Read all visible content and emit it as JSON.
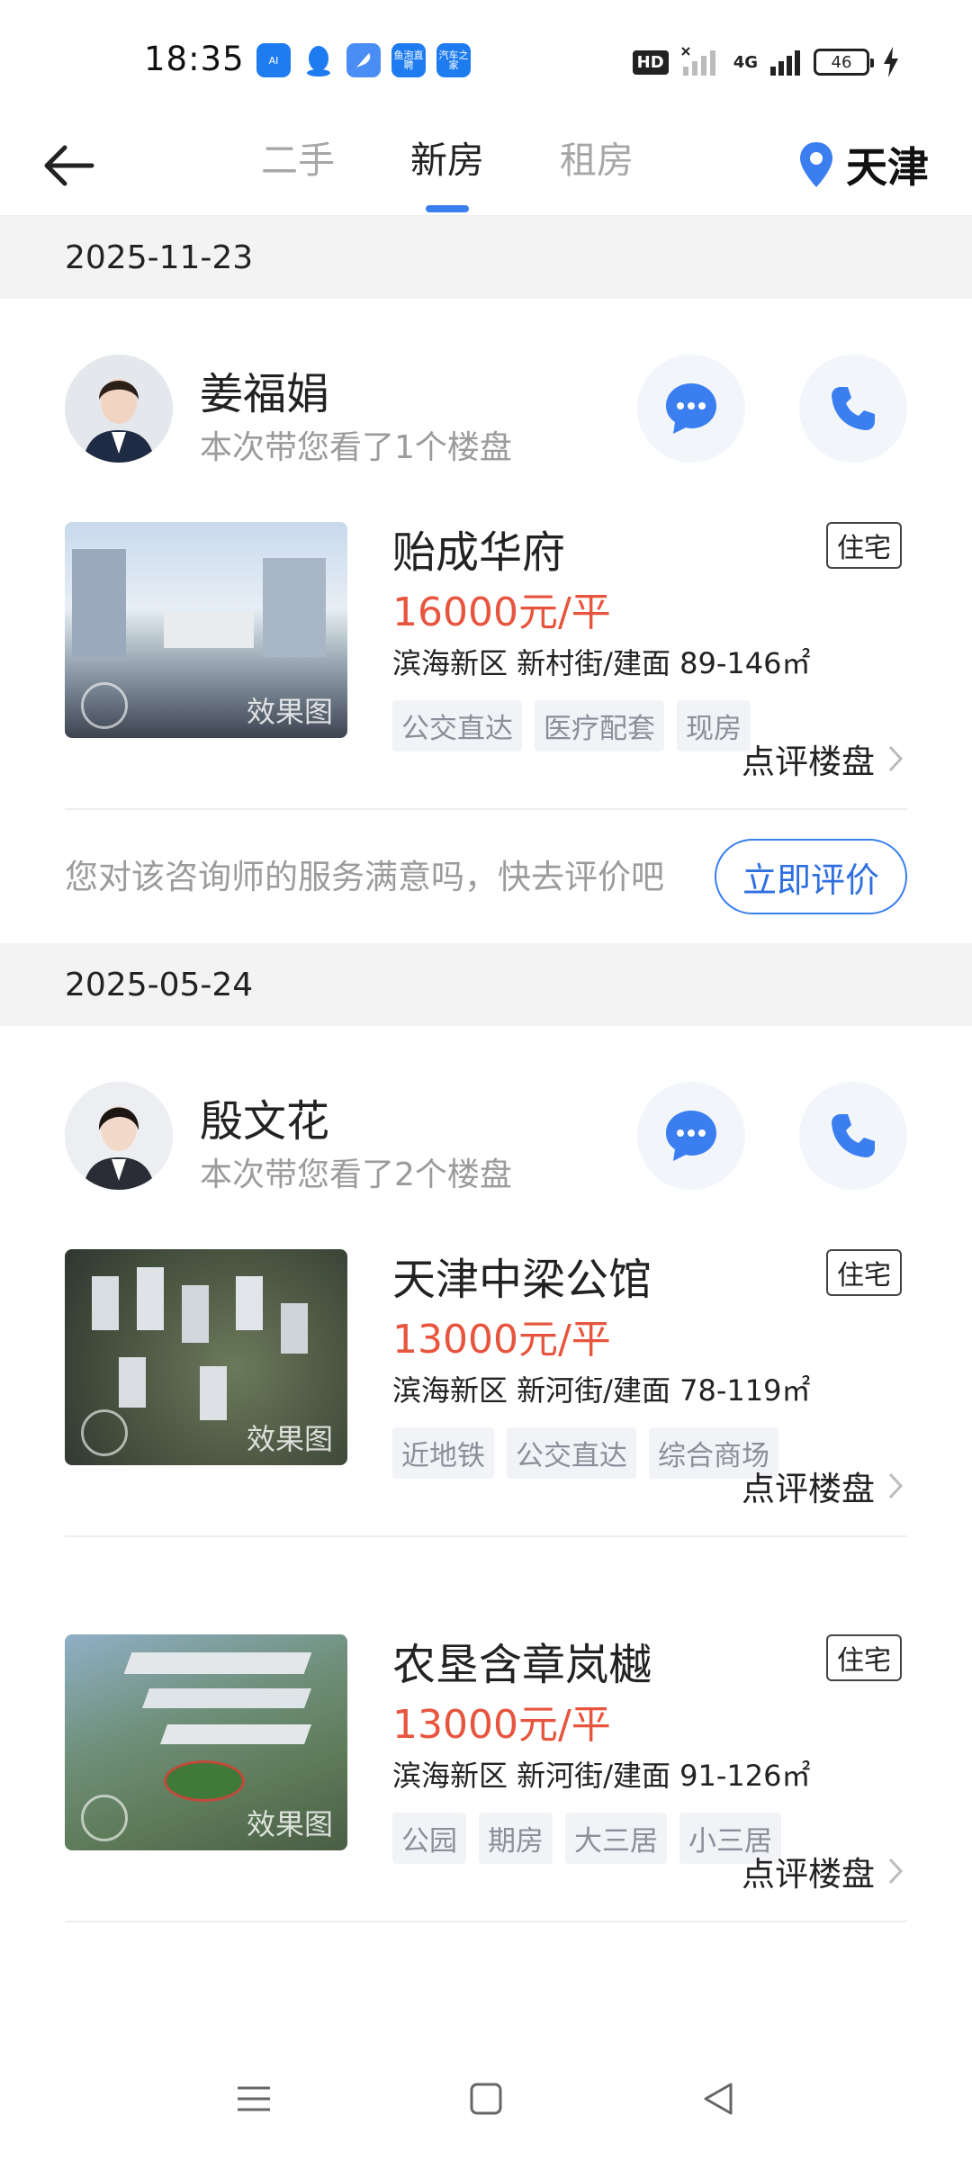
{
  "status_bar": {
    "time": "18:35",
    "app_icons": [
      {
        "name": "ai-app-icon",
        "label": "AI"
      },
      {
        "name": "qq-icon",
        "label": ""
      },
      {
        "name": "feather-icon",
        "label": ""
      },
      {
        "name": "yupao-icon",
        "label": "鱼泡直聘"
      },
      {
        "name": "weather-app-icon",
        "label": "汽车之家"
      }
    ],
    "hd_label": "HD",
    "network": "4G",
    "battery": "46"
  },
  "header": {
    "tabs": [
      {
        "label": "二手",
        "active": false
      },
      {
        "label": "新房",
        "active": true
      },
      {
        "label": "租房",
        "active": false
      }
    ],
    "city": "天津"
  },
  "sections": [
    {
      "date": "2025-11-23",
      "agent": {
        "name": "姜福娟",
        "subtitle": "本次带您看了1个楼盘"
      },
      "houses": [
        {
          "name": "贻成华府",
          "type": "住宅",
          "price": "16000元/平",
          "address": "滨海新区 新村街/建面 89-146㎡",
          "tags": [
            "公交直达",
            "医疗配套",
            "现房"
          ],
          "watermark": "效果图",
          "review_label": "点评楼盘"
        }
      ],
      "rating": {
        "prompt": "您对该咨询师的服务满意吗，快去评价吧",
        "button": "立即评价"
      }
    },
    {
      "date": "2025-05-24",
      "agent": {
        "name": "殷文花",
        "subtitle": "本次带您看了2个楼盘"
      },
      "houses": [
        {
          "name": "天津中梁公馆",
          "type": "住宅",
          "price": "13000元/平",
          "address": "滨海新区 新河街/建面 78-119㎡",
          "tags": [
            "近地铁",
            "公交直达",
            "综合商场"
          ],
          "watermark": "效果图",
          "review_label": "点评楼盘"
        },
        {
          "name": "农垦含章岚樾",
          "type": "住宅",
          "price": "13000元/平",
          "address": "滨海新区 新河街/建面 91-126㎡",
          "tags": [
            "公园",
            "期房",
            "大三居",
            "小三居"
          ],
          "watermark": "效果图",
          "review_label": "点评楼盘"
        }
      ]
    }
  ],
  "colors": {
    "accent": "#3a7ef0",
    "price": "#e8553e",
    "section_bg": "#f3f3f3"
  }
}
